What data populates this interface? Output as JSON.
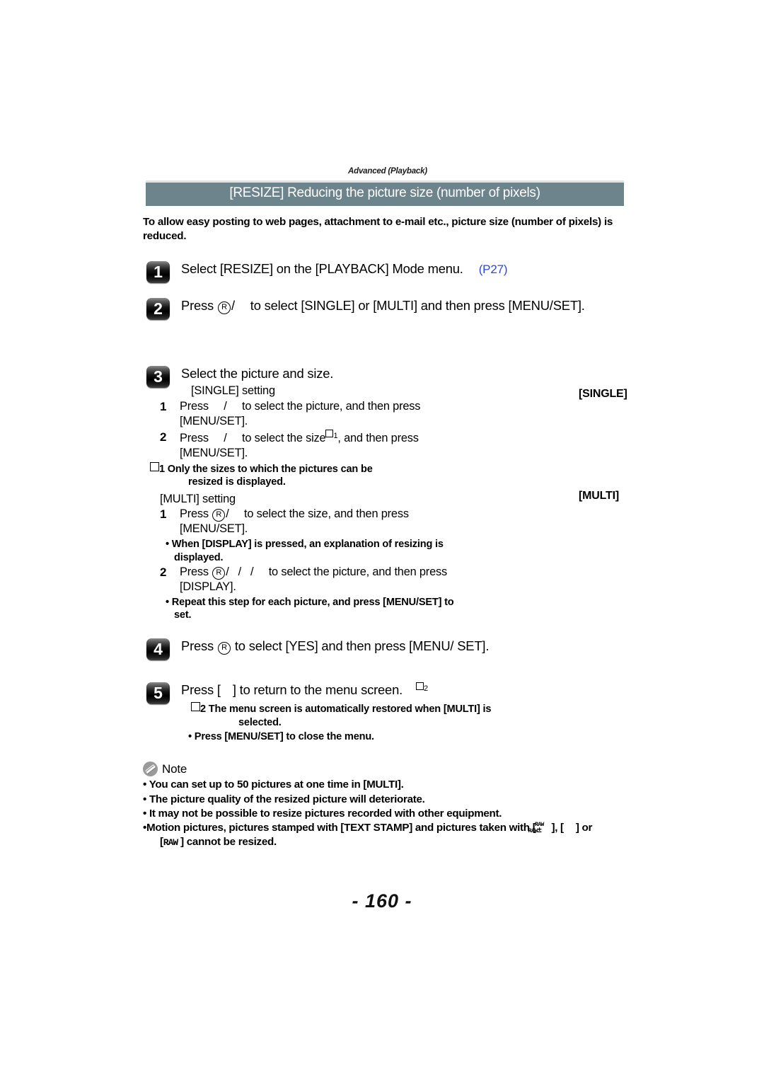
{
  "running_head": "Advanced (Playback)",
  "section_title": "[RESIZE] Reducing the picture size (number of pixels)",
  "intro": "To allow easy posting to web pages, attachment to e-mail etc., picture size (number of pixels) is reduced.",
  "colors": {
    "title_bar_bg": "#6d848c",
    "title_bar_text": "#ffffff",
    "link": "#2b48d8",
    "note_icon_bg": "#9a9a9a",
    "page_bg": "#ffffff"
  },
  "steps": [
    {
      "number": "1",
      "text": "Select [RESIZE] on the [PLAYBACK] Mode menu.",
      "page_ref": "(P27)"
    },
    {
      "number": "2",
      "text_a": "Press",
      "text_b": "to select [SINGLE] or [MULTI] and then press [MENU/SET]."
    },
    {
      "number": "3",
      "text": "Select the picture and size."
    },
    {
      "number": "4",
      "text_a": "Press",
      "text_b": "to select [YES] and then press [MENU/ SET]."
    },
    {
      "number": "5",
      "text_a": "Press [",
      "text_b": "] to return to the menu screen.",
      "footnote_marker": "2"
    }
  ],
  "single_section": {
    "heading": "[SINGLE] setting",
    "right_label": "[SINGLE]",
    "substeps": [
      {
        "n": "1",
        "a": "Press",
        "b": "to select the picture, and then press [MENU/SET]."
      },
      {
        "n": "2",
        "a": "Press",
        "b": "to select the size",
        "marker": "1",
        "c": ", and then press [MENU/SET]."
      }
    ],
    "footnote": {
      "marker": "1",
      "line1": "Only the sizes to which the pictures can be",
      "line2": "resized is displayed."
    }
  },
  "multi_section": {
    "heading": "[MULTI] setting",
    "right_label": "[MULTI]",
    "substeps": [
      {
        "n": "1",
        "a": "Press",
        "b": "to select the size, and then press [MENU/SET].",
        "bullets": [
          "When [DISPLAY] is pressed, an",
          "explanation of resizing is displayed."
        ]
      },
      {
        "n": "2",
        "a": "Press",
        "b": "to select the picture, and then press [DISPLAY].",
        "bullets": [
          "Repeat this step for each picture, and",
          "press [MENU/SET] to set."
        ]
      }
    ]
  },
  "step5_footnote": {
    "marker": "2",
    "line1": "The menu screen is automatically restored when [MULTI] is",
    "line2": "selected.",
    "bullet": "Press [MENU/SET] to close the menu."
  },
  "note": {
    "label": "Note",
    "items": [
      "You can set up to 50 pictures at one time in [MULTI].",
      "The picture quality of the resized picture will deteriorate.",
      "It may not be possible to resize pictures recorded with other equipment.",
      "Motion pictures, pictures stamped with [TEXT STAMP] and pictures taken with [",
      "], [",
      "] or",
      "] cannot be resized."
    ],
    "raw_glyph": "RAW",
    "raw_bracket_text": "RAW"
  },
  "page_number": "- 160 -"
}
